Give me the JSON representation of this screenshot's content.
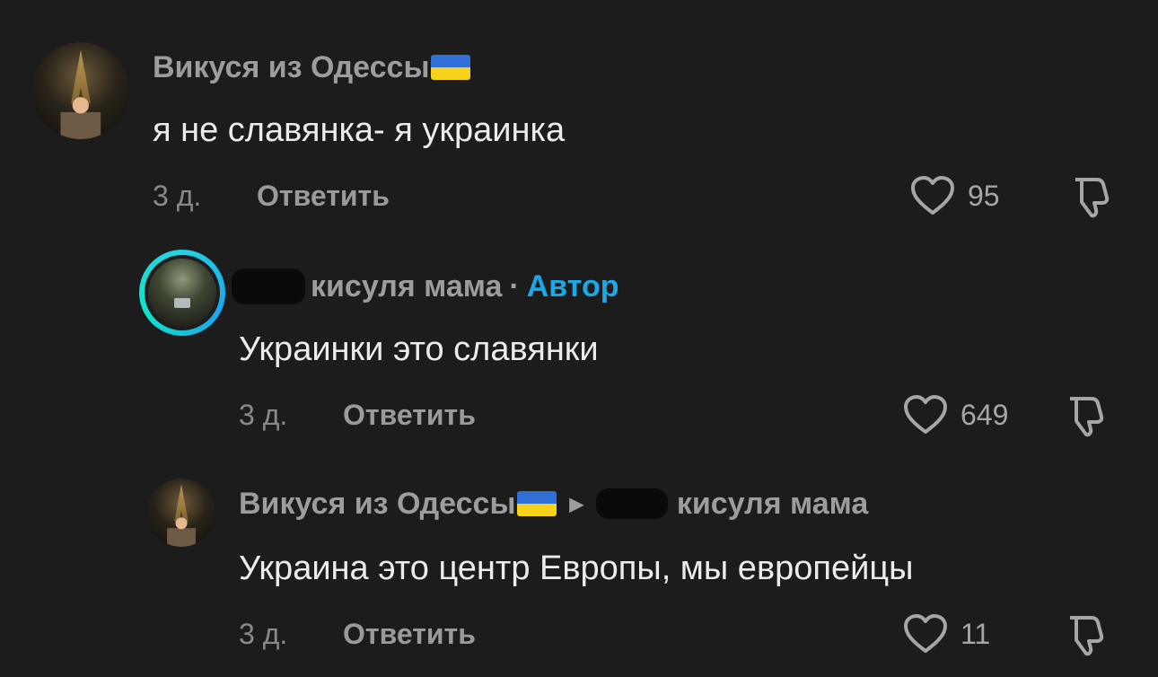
{
  "comments": [
    {
      "username": "Викуся из Одессы",
      "text": "я не славянка- я украинка",
      "time": "3 д.",
      "reply_label": "Ответить",
      "likes": "95"
    },
    {
      "username": "кисуля мама",
      "separator": "·",
      "badge": "Автор",
      "text": "Украинки это славянки",
      "time": "3 д.",
      "reply_label": "Ответить",
      "likes": "649"
    },
    {
      "username": "Викуся из Одессы",
      "reply_to": "кисуля мама",
      "text": "Украина это центр Европы, мы европейцы",
      "time": "3 д.",
      "reply_label": "Ответить",
      "likes": "11"
    }
  ],
  "colors": {
    "background": "#1c1c1c",
    "author_badge": "#1aa9e6",
    "story_ring": "#26d0e0",
    "flag_blue": "#2f6fd6",
    "flag_yellow": "#f6d21a"
  },
  "icons": [
    "heart-outline-icon",
    "thumbs-down-icon",
    "ukraine-flag-icon",
    "caret-right-icon"
  ]
}
